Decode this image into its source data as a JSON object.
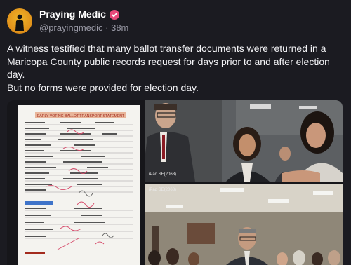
{
  "post": {
    "author_name": "Praying Medic",
    "author_handle": "@prayingmedic",
    "time_ago": "38m",
    "text_line1": "A witness testified that many ballot transfer documents were returned in a Maricopa County public records request for days prior to and after election day.",
    "text_line2": "But no forms were provided for election day."
  },
  "media": {
    "document_heading": "EARLY VOTING BALLOT TRANSPORT STATEMENT",
    "video_label_top": "iPad SE(2068)",
    "video_label_bottom": "iPad SE(2068)"
  },
  "colors": {
    "background": "#1b1b21",
    "verified_badge": "#e8497a",
    "avatar": "#e9a31c"
  }
}
